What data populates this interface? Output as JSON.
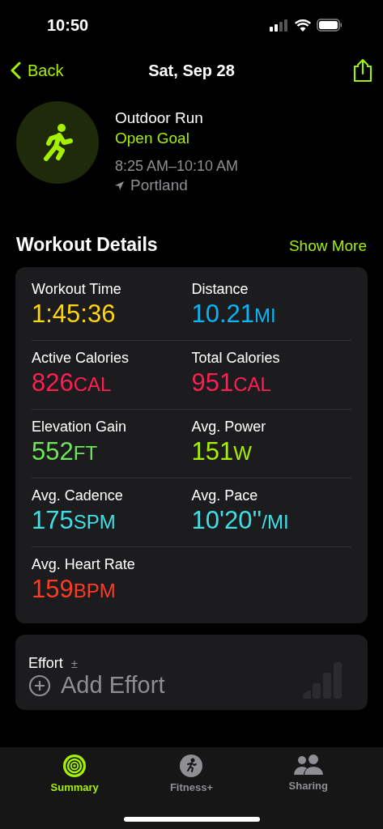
{
  "status_bar": {
    "time": "10:50"
  },
  "nav": {
    "back": "Back",
    "title": "Sat, Sep 28"
  },
  "workout": {
    "name": "Outdoor Run",
    "goal": "Open Goal",
    "time_range": "8:25 AM–10:10 AM",
    "location": "Portland"
  },
  "details": {
    "title": "Workout Details",
    "action": "Show More",
    "metrics": [
      {
        "label": "Workout Time",
        "value": "1:45:36",
        "color": "#ffd60a"
      },
      {
        "label": "Distance",
        "value": "10.21",
        "unit": "MI",
        "color": "#0ab4f5"
      },
      {
        "label": "Active Calories",
        "value": "826",
        "unit": "CAL",
        "color": "#ff1f55"
      },
      {
        "label": "Total Calories",
        "value": "951",
        "unit": "CAL",
        "color": "#ff1f55"
      },
      {
        "label": "Elevation Gain",
        "value": "552",
        "unit": "FT",
        "color": "#6ee55a"
      },
      {
        "label": "Avg. Power",
        "value": "151",
        "unit": "W",
        "color": "#a8f000"
      },
      {
        "label": "Avg. Cadence",
        "value": "175",
        "unit": "SPM",
        "color": "#3ee0e6"
      },
      {
        "label": "Avg. Pace",
        "value": "10'20''",
        "unit": "/MI",
        "color": "#3ee0e6"
      },
      {
        "label": "Avg. Heart Rate",
        "value": "159",
        "unit": "BPM",
        "color": "#ff3b22"
      }
    ]
  },
  "effort": {
    "label": "Effort",
    "symbol": "±",
    "placeholder": "Add Effort"
  },
  "tabs": [
    {
      "label": "Summary",
      "selected": true,
      "kind": "rings"
    },
    {
      "label": "Fitness+",
      "selected": false,
      "kind": "runner"
    },
    {
      "label": "Sharing",
      "selected": false,
      "kind": "people"
    }
  ]
}
